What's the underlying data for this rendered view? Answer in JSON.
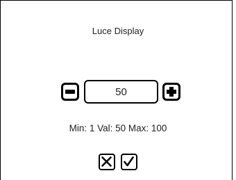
{
  "dialog": {
    "title": "Luce Display",
    "value": "50",
    "range_text": "Min: 1 Val: 50 Max: 100",
    "min": 1,
    "max": 100
  },
  "icons": {
    "decrement": "minus-icon",
    "increment": "plus-icon",
    "cancel": "close-icon",
    "confirm": "check-icon"
  }
}
